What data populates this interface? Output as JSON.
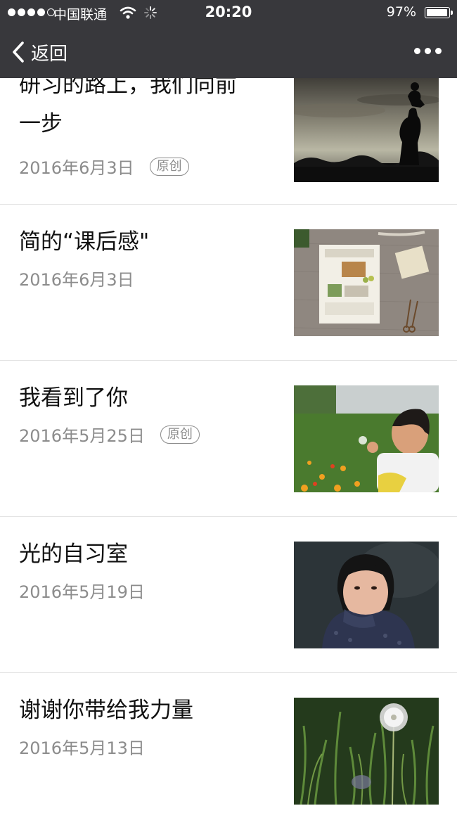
{
  "status_bar": {
    "carrier": "中国联通",
    "time": "20:20",
    "battery_percent": "97%",
    "battery_level": 0.97,
    "signal_bars": 4
  },
  "nav": {
    "back_label": "返回"
  },
  "articles": [
    {
      "title_lines": [
        "研习的路上，我们向前",
        "一步"
      ],
      "date": "2016年6月3日",
      "badge": "原创",
      "thumbnail": "silhouette-parent-child-sunset"
    },
    {
      "title": "简的“课后感\"",
      "date": "2016年6月3日",
      "thumbnail": "book-on-linen"
    },
    {
      "title": "我看到了你",
      "date": "2016年5月25日",
      "badge": "原创",
      "thumbnail": "boy-blowing-dandelion"
    },
    {
      "title": "光的自习室",
      "date": "2016年5月19日",
      "thumbnail": "girl-portrait-sweater"
    },
    {
      "title": "谢谢你带给我力量",
      "date": "2016年5月13日",
      "thumbnail": "dandelion-in-grass"
    }
  ]
}
